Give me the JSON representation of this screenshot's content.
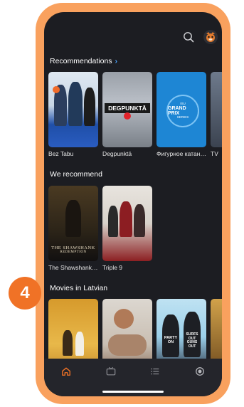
{
  "colors": {
    "frame": "#f9a15e",
    "screen_bg": "#1c1d22",
    "accent_link": "#4aa3ff",
    "tab_active": "#f07226",
    "tab_inactive": "#8b8c92",
    "badge": "#f07226"
  },
  "topbar": {
    "search_icon": "search-icon",
    "avatar_icon": "cat-face-icon"
  },
  "sections": [
    {
      "title": "Recommendations",
      "has_link": true,
      "link_icon": "chevron-right-icon",
      "link_glyph": "›",
      "items": [
        {
          "caption": "Bez Tabu"
        },
        {
          "caption": "Degpunktā",
          "poster_text": "DEGPUNKTĀ"
        },
        {
          "caption": "Фигурное катание",
          "poster_text_top": "ISU",
          "poster_text_main": "GRAND PRIX",
          "poster_text_bottom": "SERIES"
        },
        {
          "caption": "TV"
        }
      ]
    },
    {
      "title": "We recommend",
      "items": [
        {
          "caption": "The Shawshank Redemption",
          "poster_text": "THE SHAWSHANK",
          "poster_subtext": "REDEMPTION"
        },
        {
          "caption": "Triple 9"
        }
      ]
    },
    {
      "title": "Movies in Latvian",
      "items": [
        {
          "caption": ""
        },
        {
          "caption": ""
        },
        {
          "caption": "",
          "poster_text": "PARTY ON",
          "poster_text2": "SURFS OUT GUNS OUT"
        },
        {
          "caption": ""
        }
      ]
    }
  ],
  "tabbar": {
    "tabs": [
      {
        "icon": "home-icon",
        "active": true
      },
      {
        "icon": "tv-icon",
        "active": false
      },
      {
        "icon": "list-icon",
        "active": false
      },
      {
        "icon": "record-icon",
        "active": false
      }
    ]
  },
  "step_badge": "4"
}
